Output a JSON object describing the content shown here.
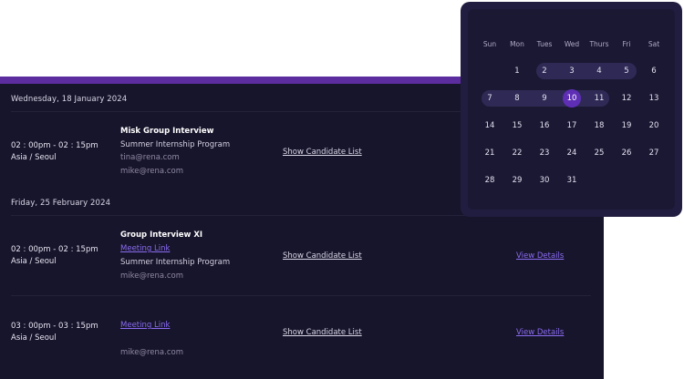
{
  "calendar": {
    "weekdays": [
      "Sun",
      "Mon",
      "Tues",
      "Wed",
      "Thurs",
      "Fri",
      "Sat"
    ],
    "selected_day": "10",
    "range_start": "2",
    "range_end": "11",
    "weeks": [
      [
        "",
        "1",
        "2",
        "3",
        "4",
        "5",
        "6"
      ],
      [
        "7",
        "8",
        "9",
        "10",
        "11",
        "12",
        "13"
      ],
      [
        "14",
        "15",
        "16",
        "17",
        "18",
        "19",
        "20"
      ],
      [
        "21",
        "22",
        "23",
        "24",
        "25",
        "26",
        "27"
      ],
      [
        "28",
        "29",
        "30",
        "31",
        "",
        "",
        ""
      ]
    ],
    "colors": {
      "range": "#2f2a55",
      "selected": "#5e2fb5"
    }
  },
  "schedule": {
    "groups": [
      {
        "date": "Wednesday, 18 January 2024",
        "events": [
          {
            "time": "02 : 00pm  -  02 : 15pm",
            "timezone": "Asia  / Seoul",
            "title": "Misk Group Interview",
            "program": "Summer Internship Program",
            "email1": "tina@rena.com",
            "email2": "mike@rena.com",
            "candidate_link": "Show Candidate List"
          }
        ]
      },
      {
        "date": "Friday, 25 February 2024",
        "events": [
          {
            "time": "02 : 00pm  -  02 : 15pm",
            "timezone": "Asia  / Seoul",
            "title": "Group Interview XI",
            "meeting_link": "Meeting Link",
            "program": "Summer Internship Program",
            "email": "mike@rena.com",
            "candidate_link": "Show Candidate List",
            "details_link": "View Details"
          },
          {
            "time": "03 : 00pm  -  03 : 15pm",
            "timezone": "Asia  / Seoul",
            "meeting_link": "Meeting Link",
            "email": "mike@rena.com",
            "candidate_link": "Show Candidate List",
            "details_link": "View Details"
          }
        ]
      }
    ]
  }
}
